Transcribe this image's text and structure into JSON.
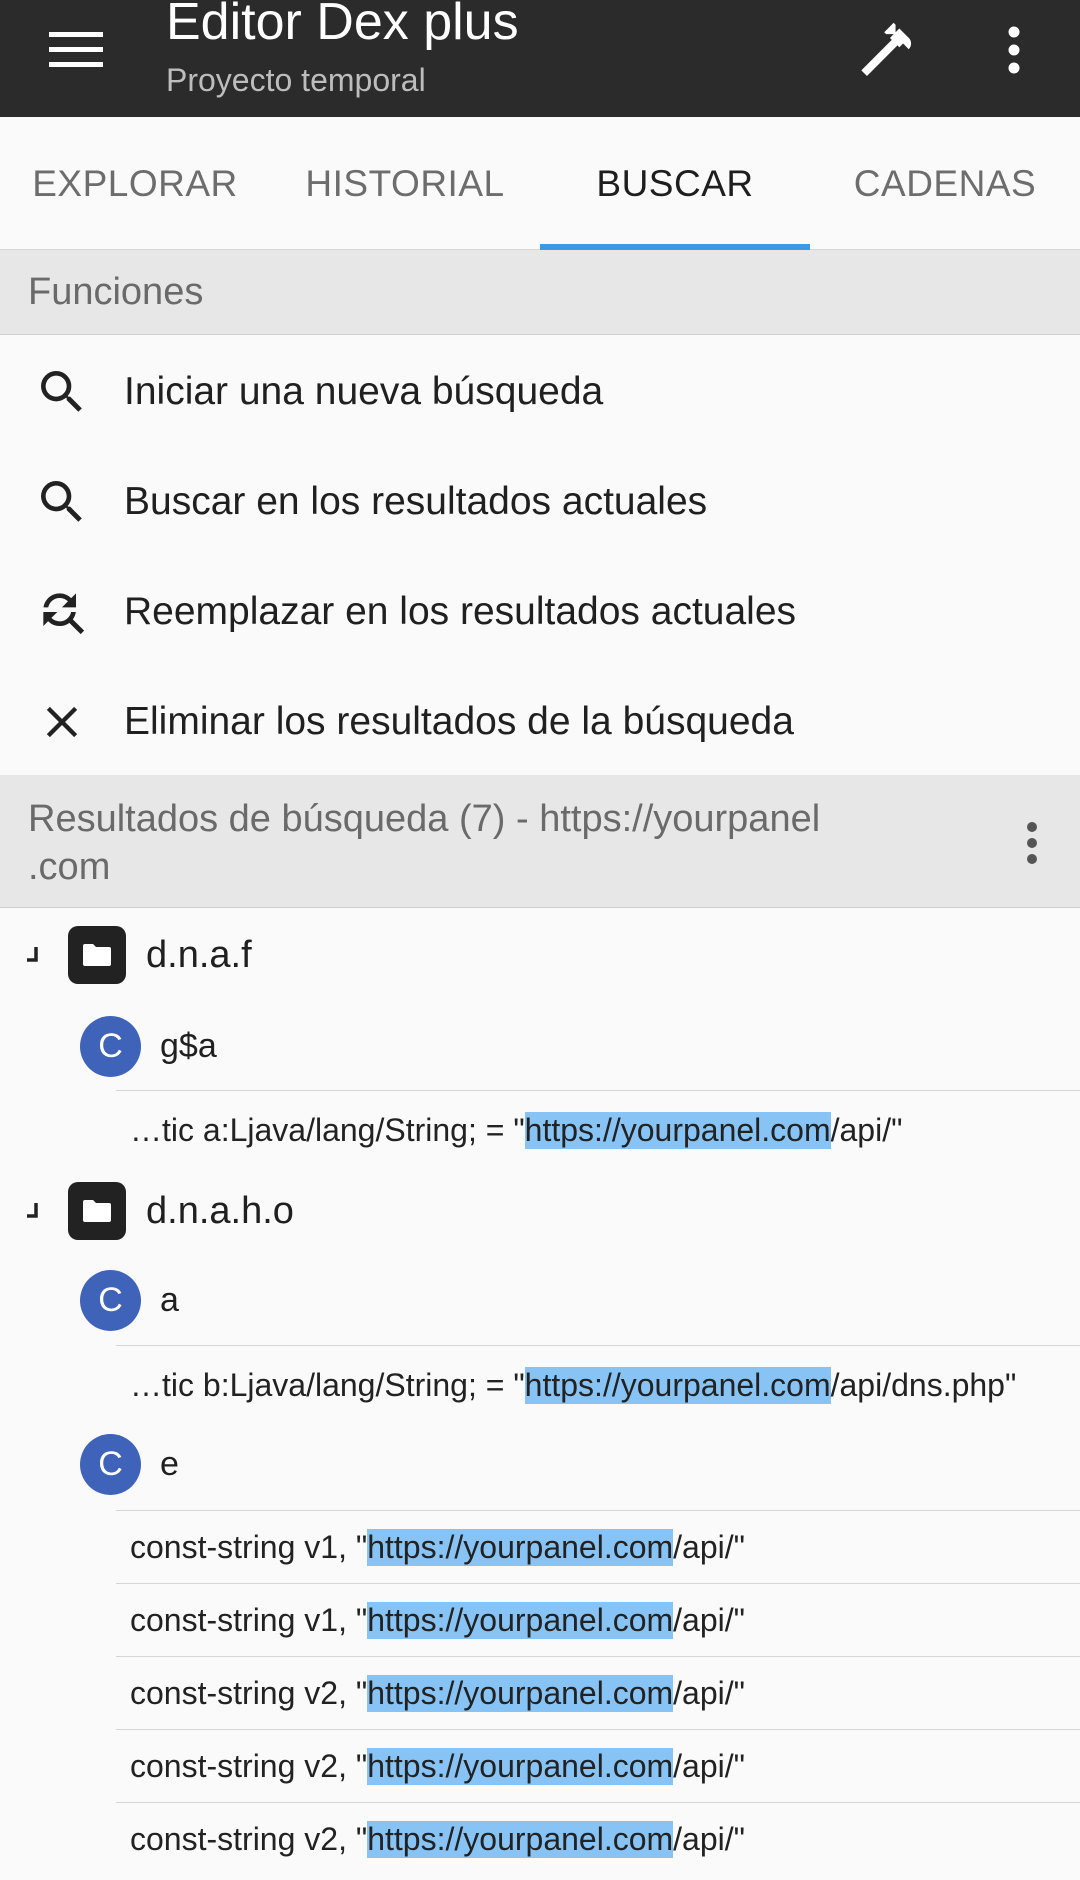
{
  "appbar": {
    "title": "Editor Dex plus",
    "subtitle": "Proyecto temporal",
    "icons": [
      "menu-icon",
      "hammer-icon",
      "more-vert-icon"
    ]
  },
  "tabs": [
    {
      "label": "EXPLORAR"
    },
    {
      "label": "HISTORIAL"
    },
    {
      "label": "BUSCAR",
      "active": true
    },
    {
      "label": "CADENAS"
    }
  ],
  "functions": {
    "header": "Funciones",
    "items": [
      {
        "label": "Iniciar una nueva búsqueda",
        "icon": "search-icon"
      },
      {
        "label": "Buscar en los resultados actuales",
        "icon": "search-icon"
      },
      {
        "label": "Reemplazar en los resultados actuales",
        "icon": "find-replace-icon"
      },
      {
        "label": "Eliminar los resultados de la búsqueda",
        "icon": "close-icon"
      }
    ]
  },
  "results": {
    "header_line1": "Resultados de búsqueda (7) - https://yourpanel",
    "header_line2": ".com",
    "packages": [
      {
        "name": "d.n.a.f",
        "classes": [
          {
            "badge": "C",
            "name": "g$a",
            "lines": [
              {
                "pre": "…tic a:Ljava/lang/String; = \"",
                "match": "https://yourpanel.com",
                "post": "/api/\""
              }
            ]
          }
        ]
      },
      {
        "name": "d.n.a.h.o",
        "classes": [
          {
            "badge": "C",
            "name": "a",
            "lines": [
              {
                "pre": "…tic b:Ljava/lang/String; = \"",
                "match": "https://yourpanel.com",
                "post": "/api/dns.php\""
              }
            ]
          },
          {
            "badge": "C",
            "name": "e",
            "lines": [
              {
                "pre": "const-string v1, \"",
                "match": "https://yourpanel.com",
                "post": "/api/\""
              },
              {
                "pre": "const-string v1, \"",
                "match": "https://yourpanel.com",
                "post": "/api/\""
              },
              {
                "pre": "const-string v2, \"",
                "match": "https://yourpanel.com",
                "post": "/api/\""
              },
              {
                "pre": "const-string v2, \"",
                "match": "https://yourpanel.com",
                "post": "/api/\""
              },
              {
                "pre": "const-string v2, \"",
                "match": "https://yourpanel.com",
                "post": "/api/\""
              }
            ]
          }
        ]
      }
    ]
  },
  "colors": {
    "appbar": "#2b2b2b",
    "tab_indicator": "#3c98e8",
    "class_badge": "#3f63b8",
    "highlight": "#87c4f5"
  }
}
